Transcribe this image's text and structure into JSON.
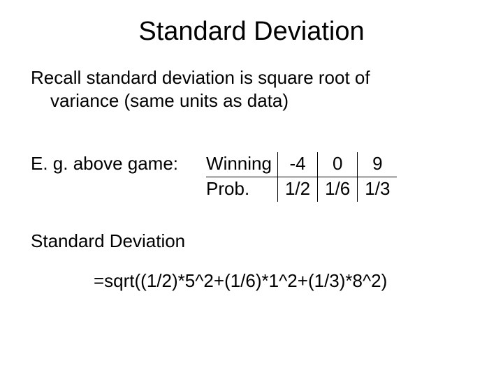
{
  "title": "Standard Deviation",
  "para1_line1": "Recall standard deviation is square root of",
  "para1_line2": "variance (same units as data)",
  "eg_label": "E. g. above game:",
  "table": {
    "row1_label": "Winning",
    "row2_label": "Prob.",
    "cols": {
      "c1": {
        "win": "-4",
        "prob": "1/2"
      },
      "c2": {
        "win": "0",
        "prob": "1/6"
      },
      "c3": {
        "win": "9",
        "prob": "1/3"
      }
    }
  },
  "sd_label": "Standard Deviation",
  "formula": "=sqrt((1/2)*5^2+(1/6)*1^2+(1/3)*8^2)"
}
